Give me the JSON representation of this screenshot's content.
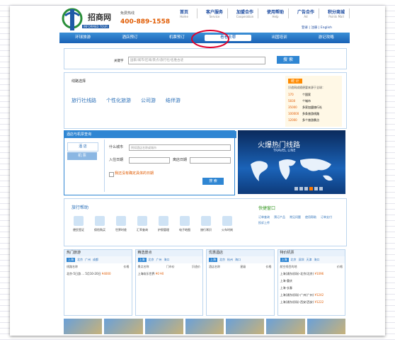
{
  "header": {
    "brand": "招商网",
    "brand_en": "INFORMED TOUR",
    "hotline_label": "免费热线",
    "phone": "400-889-1558",
    "top_nav": [
      {
        "label": "首页",
        "en": "Home"
      },
      {
        "label": "客户服务",
        "en": "Service"
      },
      {
        "label": "加盟合作",
        "en": "Cooperation"
      },
      {
        "label": "使用帮助",
        "en": "Help"
      },
      {
        "label": "广告合作",
        "en": "Ad"
      },
      {
        "label": "积分商城",
        "en": "Points Mall"
      }
    ],
    "top_links": "登录 | 注册 | English"
  },
  "navbar": [
    "环球旅游",
    "酒店预订",
    "机票预订",
    "看看去哪",
    "出国培训",
    "游记攻略"
  ],
  "search": {
    "label": "关键字",
    "placeholder": "国家/城市/区域/景点/旅行社/名胜古迹",
    "button": "搜 索"
  },
  "routes": {
    "title": "线路选择",
    "items": [
      "旅行社线路",
      "个性化旅游",
      "公司游",
      "结伴游"
    ]
  },
  "stats": {
    "tag": "统 计",
    "intro": "识途网成随便要来源于全球：",
    "rows": [
      {
        "num": "170",
        "text": "个国家"
      },
      {
        "num": "5830",
        "text": "个城市"
      },
      {
        "num": "35000",
        "text": "多家加盟旅行社"
      },
      {
        "num": "100000",
        "text": "多条旅游线路"
      },
      {
        "num": "12000",
        "text": "多个旅游景点"
      }
    ]
  },
  "booking": {
    "title": "酒店与机票查询",
    "tabs": [
      "酒 店",
      "机 票"
    ],
    "city_label": "什么城市",
    "city_placeholder": "例如酒店名称或城市",
    "checkin_label": "入住日期",
    "checkout_label": "离店日期",
    "checkbox_label": "我还没有确定具体的日期",
    "button": "搜 索"
  },
  "promo": {
    "title": "火爆热门线路",
    "subtitle": "TRAVEL LINE"
  },
  "help": {
    "title": "旅行帮助",
    "items": [
      "便民签证",
      "保险购买",
      "世界时差",
      "汇率查询",
      "护照管理",
      "电子地图",
      "旅行常识",
      "火车时刻"
    ]
  },
  "quick": {
    "title": "快捷窗口",
    "links": [
      "订单查询",
      "预订产品",
      "常见问题",
      "使用帮助",
      "订单支付",
      "投诉上传"
    ]
  },
  "panels": [
    {
      "title": "热门旅游",
      "cities": [
        "上海",
        "北京",
        "广州",
        "成都"
      ],
      "cols": [
        "线路名称",
        "价格"
      ],
      "rows": [
        {
          "name": "北京-5日游 ... 5月10-20日",
          "price": "¥4000"
        }
      ]
    },
    {
      "title": "精选景点",
      "cities": [
        "上海",
        "北京",
        "广州",
        "海口"
      ],
      "cols": [
        "景点名称",
        "门市价",
        "识途价"
      ],
      "rows": [
        {
          "name": "上海欢乐世界",
          "price": "¥0  ¥0"
        }
      ]
    },
    {
      "title": "优惠酒店",
      "cities": [
        "上海",
        "北京",
        "杭州",
        "海口"
      ],
      "cols": [
        "酒店名称",
        "星级",
        "价格"
      ],
      "rows": []
    },
    {
      "title": "特价机票",
      "cities": [
        "上海",
        "北京",
        "深圳",
        "天津",
        "海口"
      ],
      "cols": [
        "航空线目的地",
        "价格"
      ],
      "rows": [
        {
          "name": "上海(浦东机场)-北京(北京)",
          "price": "¥1096"
        },
        {
          "name": "上海-重庆",
          "price": ""
        },
        {
          "name": "上海-长春",
          "price": ""
        },
        {
          "name": "上海(浦东机场)-广州(广州)",
          "price": "¥1242"
        },
        {
          "name": "上海(浦东机场)-西安(西安)",
          "price": "¥1222"
        }
      ]
    }
  ]
}
